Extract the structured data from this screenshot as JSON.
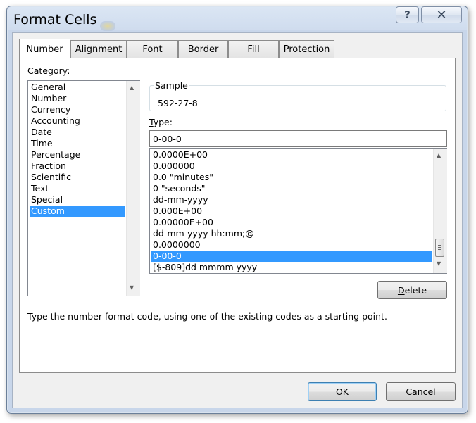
{
  "window": {
    "title": "Format Cells",
    "help_glyph": "?",
    "close_glyph": "✕"
  },
  "tabs": [
    {
      "label": "Number",
      "active": true
    },
    {
      "label": "Alignment",
      "active": false
    },
    {
      "label": "Font",
      "active": false
    },
    {
      "label": "Border",
      "active": false
    },
    {
      "label": "Fill",
      "active": false
    },
    {
      "label": "Protection",
      "active": false
    }
  ],
  "category": {
    "label_prefix": "",
    "label_underlined": "C",
    "label_rest": "ategory:",
    "items": [
      "General",
      "Number",
      "Currency",
      "Accounting",
      "Date",
      "Time",
      "Percentage",
      "Fraction",
      "Scientific",
      "Text",
      "Special",
      "Custom"
    ],
    "selected": "Custom"
  },
  "sample": {
    "label": "Sample",
    "value": "592-27-8"
  },
  "type": {
    "label_underlined": "T",
    "label_rest": "ype:",
    "value": "0-00-0"
  },
  "formats": {
    "items": [
      "0.0000E+00",
      "0.000000",
      "0.0 \"minutes\"",
      "0 \"seconds\"",
      "dd-mm-yyyy",
      "0.000E+00",
      "0.00000E+00",
      "dd-mm-yyyy hh:mm;@",
      "0.0000000",
      "0-00-0",
      "[$-809]dd mmmm yyyy"
    ],
    "selected": "0-00-0"
  },
  "buttons": {
    "delete_underlined": "D",
    "delete_rest": "elete",
    "ok": "OK",
    "cancel": "Cancel"
  },
  "hint": "Type the number format code, using one of the existing codes as a starting point.",
  "icons": {
    "scroll_up": "▲",
    "scroll_down": "▼"
  },
  "colors": {
    "selection": "#3399ff",
    "frame": "#c8d6ea"
  }
}
